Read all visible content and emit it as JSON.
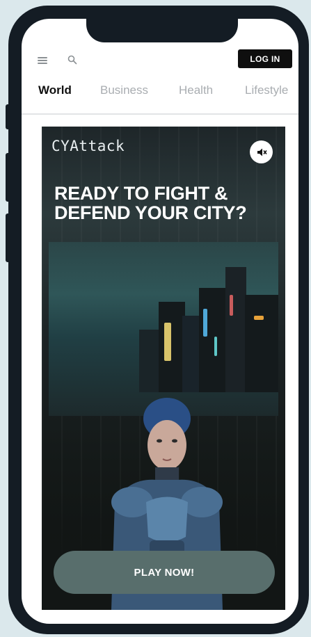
{
  "header": {
    "login_label": "LOG IN",
    "menu_icon": "hamburger-menu-icon",
    "search_icon": "search-icon"
  },
  "tabs": [
    {
      "label": "World",
      "active": true
    },
    {
      "label": "Business",
      "active": false
    },
    {
      "label": "Health",
      "active": false
    },
    {
      "label": "Lifestyle",
      "active": false
    }
  ],
  "ad": {
    "brand": "CYAttack",
    "mute_icon": "speaker-muted-icon",
    "headline_line1": "READY TO FIGHT &",
    "headline_line2": "DEFEND YOUR CITY?",
    "cta_label": "PLAY NOW!"
  },
  "colors": {
    "page_background": "#dbe8ec",
    "phone_frame": "#141c24",
    "cta_background": "#586e6c"
  }
}
